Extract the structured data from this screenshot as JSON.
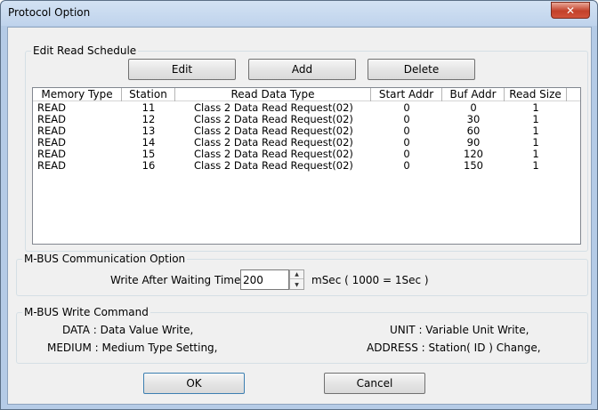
{
  "window": {
    "title": "Protocol Option",
    "close_glyph": "✕"
  },
  "schedule": {
    "group_label": "Edit Read Schedule",
    "edit_label": "Edit",
    "add_label": "Add",
    "delete_label": "Delete",
    "columns": [
      "Memory Type",
      "Station",
      "Read Data Type",
      "Start Addr",
      "Buf Addr",
      "Read Size"
    ],
    "rows": [
      [
        "READ",
        "11",
        "Class 2 Data Read Request(02)",
        "0",
        "0",
        "1"
      ],
      [
        "READ",
        "12",
        "Class 2 Data Read Request(02)",
        "0",
        "30",
        "1"
      ],
      [
        "READ",
        "13",
        "Class 2 Data Read Request(02)",
        "0",
        "60",
        "1"
      ],
      [
        "READ",
        "14",
        "Class 2 Data Read Request(02)",
        "0",
        "90",
        "1"
      ],
      [
        "READ",
        "15",
        "Class 2 Data Read Request(02)",
        "0",
        "120",
        "1"
      ],
      [
        "READ",
        "16",
        "Class 2 Data Read Request(02)",
        "0",
        "150",
        "1"
      ]
    ]
  },
  "comm": {
    "group_label": "M-BUS Communication Option",
    "wait_label": "Write After Waiting Time :",
    "wait_value": "200",
    "unit_text": "mSec ( 1000 = 1Sec )"
  },
  "write_cmd": {
    "group_label": "M-BUS Write Command",
    "data_text": "DATA : Data Value Write,",
    "medium_text": "MEDIUM : Medium Type Setting,",
    "unit_text": "UNIT : Variable Unit Write,",
    "address_text": "ADDRESS : Station( ID ) Change,"
  },
  "footer": {
    "ok_label": "OK",
    "cancel_label": "Cancel"
  }
}
